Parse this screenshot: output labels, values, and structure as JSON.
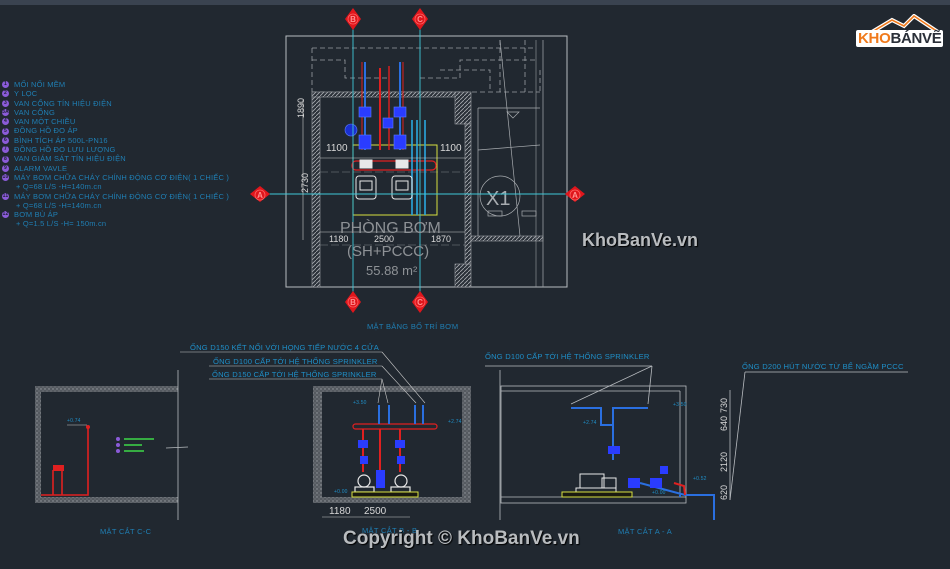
{
  "legend": {
    "items": [
      {
        "num": "1",
        "label": "MỐI NỐI MỀM"
      },
      {
        "num": "2",
        "label": "Y LỌC"
      },
      {
        "num": "3",
        "label": "VAN CỔNG TÍN HIỆU ĐIỆN"
      },
      {
        "num": "3A",
        "label": "VAN CỔNG"
      },
      {
        "num": "4",
        "label": "VAN MỘT CHIỀU"
      },
      {
        "num": "5",
        "label": "ĐỒNG HỒ ĐO ÁP"
      },
      {
        "num": "6",
        "label": "BÌNH TÍCH ÁP 500L-PN16"
      },
      {
        "num": "7",
        "label": "ĐỒNG HỒ ĐO LƯU LƯỢNG"
      },
      {
        "num": "8",
        "label": "VAN GIÁM SÁT TÍN HIỆU ĐIỆN"
      },
      {
        "num": "9",
        "label": "ALARM VAVLE"
      },
      {
        "num": "10",
        "label": "MÁY BƠM CHỮA CHÁY CHÍNH ĐỘNG CƠ ĐIỆN( 1 CHIẾC )",
        "sub": "+ Q=68 L/S -H=140m.cn"
      },
      {
        "num": "11",
        "label": "MÁY BƠM CHỮA CHÁY CHÍNH ĐỘNG CƠ ĐIỆN( 1 CHIẾC )",
        "sub": "+ Q=68 L/S -H=140m.cn"
      },
      {
        "num": "12",
        "label": "BƠM BÙ ÁP",
        "sub": "+ Q=1.5 L/S -H= 150m.cn"
      }
    ]
  },
  "plan": {
    "title": "MẶT BẰNG BỐ TRÍ BƠM",
    "room_name": "PHÒNG BƠM",
    "room_sub": "(SH+PCCC)",
    "room_area": "55.88 m²",
    "dims": {
      "top_left": "1100",
      "top_right": "1100",
      "bottom_a": "1180",
      "bottom_b": "2500",
      "bottom_c": "1870",
      "vert_a": "1890",
      "vert_b": "2730"
    },
    "section_markers": {
      "a": "A",
      "b": "B",
      "c": "C"
    },
    "stair_label": "X1"
  },
  "sections": {
    "cc": {
      "title": "MẶT CẮT C-C",
      "level": "+0.74"
    },
    "bb": {
      "title": "MẶT CẮT B - B",
      "notes": [
        "ỐNG D150 KẾT NỐI VỚI HỌNG TIẾP NƯỚC 4 CỬA",
        "ỐNG D100 CẤP TỚI HỆ THỐNG SPRINKLER",
        "ỐNG D150 CẤP TỚI HỆ THỐNG SPRINKLER"
      ],
      "levels": {
        "top": "+3.50",
        "right": "+2.74",
        "bottom": "+0.00"
      },
      "dims": {
        "a": "1180",
        "b": "2500"
      }
    },
    "aa": {
      "title": "MẶT CẮT A - A",
      "notes": [
        "ỐNG D100 CẤP TỚI HỆ THỐNG SPRINKLER",
        "ỐNG D200 HÚT NƯỚC TỪ BỂ NGẦM PCCC"
      ],
      "levels": {
        "top": "+3.50",
        "mid": "+2.74",
        "right": "+0.52",
        "bottom": "+0.00"
      },
      "dims": {
        "a": "730",
        "b": "640",
        "c": "2120",
        "d": "620"
      }
    }
  },
  "watermarks": {
    "logo_kho": "KHO",
    "logo_banve": "BÁNVẼ",
    "mid": "KhoBanVe.vn",
    "bottom": "Copyright © KhoBanVe.vn"
  },
  "colors": {
    "background": "#212830",
    "text_blue": "#1f7fb4",
    "marker_red": "#e0161c",
    "axis_cyan": "#3ec8d8",
    "pipe_red": "#e02020",
    "pipe_blue": "#2a6fe0"
  }
}
